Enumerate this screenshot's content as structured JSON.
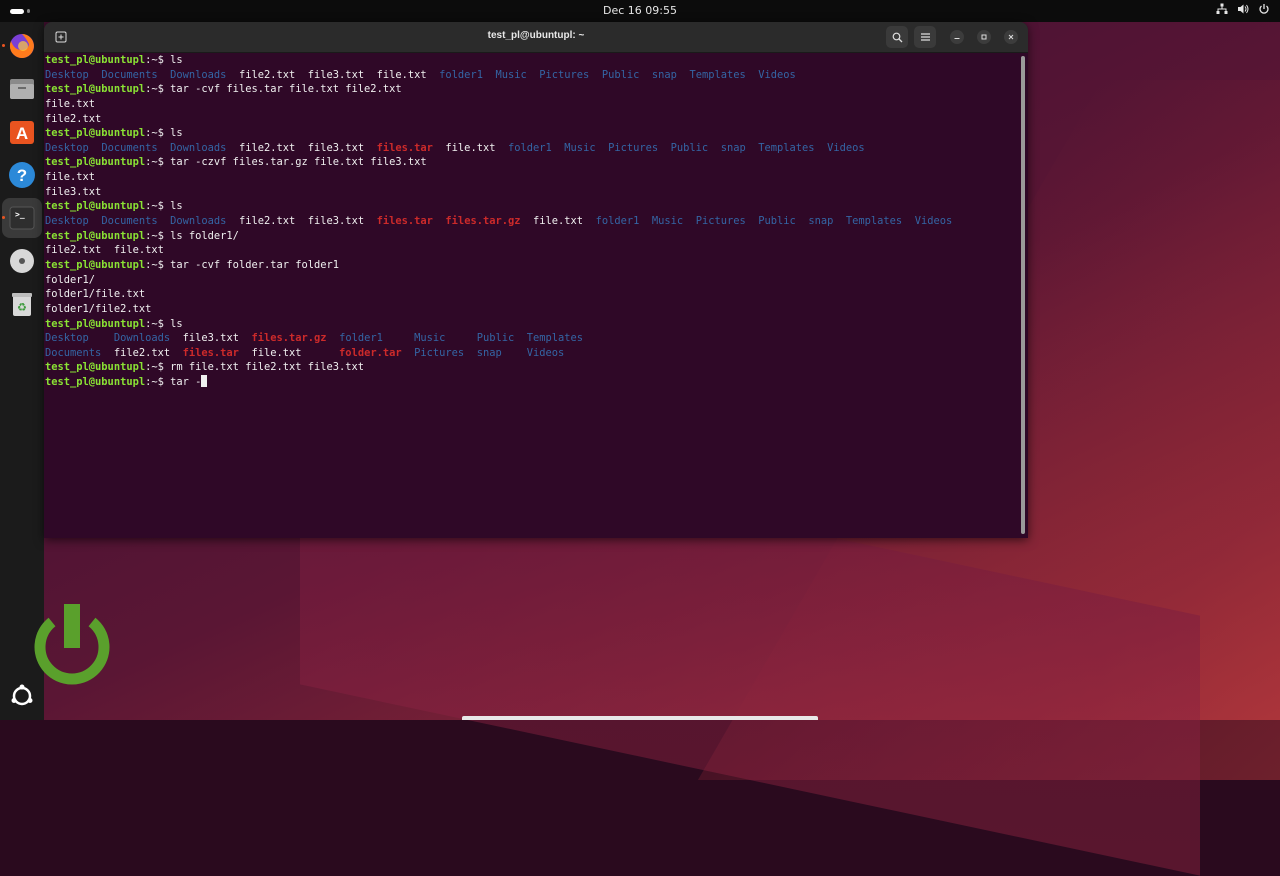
{
  "topbar": {
    "clock": "Dec 16  09:55",
    "tray_icons": [
      "network-icon",
      "volume-icon",
      "power-icon"
    ]
  },
  "dock": {
    "items": [
      "firefox-icon",
      "files-icon",
      "app-center-icon",
      "help-icon",
      "terminal-icon",
      "disc-icon",
      "trash-icon"
    ],
    "apps_icon": "show-apps-icon"
  },
  "terminal": {
    "title": "test_pl@ubuntupl: ~",
    "prompt_user": "test_pl@ubuntupl",
    "prompt_sep": ":~$ ",
    "lines": [
      {
        "type": "cmd",
        "text": "ls"
      },
      {
        "type": "out",
        "parts": [
          [
            "dir",
            "Desktop"
          ],
          [
            "pc",
            "  "
          ],
          [
            "dir",
            "Documents"
          ],
          [
            "pc",
            "  "
          ],
          [
            "dir",
            "Downloads"
          ],
          [
            "pc",
            "  file2.txt  file3.txt  file.txt  "
          ],
          [
            "dir",
            "folder1"
          ],
          [
            "pc",
            "  "
          ],
          [
            "dir",
            "Music"
          ],
          [
            "pc",
            "  "
          ],
          [
            "dir",
            "Pictures"
          ],
          [
            "pc",
            "  "
          ],
          [
            "dir",
            "Public"
          ],
          [
            "pc",
            "  "
          ],
          [
            "dir",
            "snap"
          ],
          [
            "pc",
            "  "
          ],
          [
            "dir",
            "Templates"
          ],
          [
            "pc",
            "  "
          ],
          [
            "dir",
            "Videos"
          ]
        ]
      },
      {
        "type": "cmd",
        "text": "tar -cvf files.tar file.txt file2.txt"
      },
      {
        "type": "out",
        "parts": [
          [
            "pc",
            "file.txt"
          ]
        ]
      },
      {
        "type": "out",
        "parts": [
          [
            "pc",
            "file2.txt"
          ]
        ]
      },
      {
        "type": "cmd",
        "text": "ls"
      },
      {
        "type": "out",
        "parts": [
          [
            "dir",
            "Desktop"
          ],
          [
            "pc",
            "  "
          ],
          [
            "dir",
            "Documents"
          ],
          [
            "pc",
            "  "
          ],
          [
            "dir",
            "Downloads"
          ],
          [
            "pc",
            "  file2.txt  file3.txt  "
          ],
          [
            "arc",
            "files.tar"
          ],
          [
            "pc",
            "  file.txt  "
          ],
          [
            "dir",
            "folder1"
          ],
          [
            "pc",
            "  "
          ],
          [
            "dir",
            "Music"
          ],
          [
            "pc",
            "  "
          ],
          [
            "dir",
            "Pictures"
          ],
          [
            "pc",
            "  "
          ],
          [
            "dir",
            "Public"
          ],
          [
            "pc",
            "  "
          ],
          [
            "dir",
            "snap"
          ],
          [
            "pc",
            "  "
          ],
          [
            "dir",
            "Templates"
          ],
          [
            "pc",
            "  "
          ],
          [
            "dir",
            "Videos"
          ]
        ]
      },
      {
        "type": "cmd",
        "text": "tar -czvf files.tar.gz file.txt file3.txt"
      },
      {
        "type": "out",
        "parts": [
          [
            "pc",
            "file.txt"
          ]
        ]
      },
      {
        "type": "out",
        "parts": [
          [
            "pc",
            "file3.txt"
          ]
        ]
      },
      {
        "type": "cmd",
        "text": "ls"
      },
      {
        "type": "out",
        "parts": [
          [
            "dir",
            "Desktop"
          ],
          [
            "pc",
            "  "
          ],
          [
            "dir",
            "Documents"
          ],
          [
            "pc",
            "  "
          ],
          [
            "dir",
            "Downloads"
          ],
          [
            "pc",
            "  file2.txt  file3.txt  "
          ],
          [
            "arc",
            "files.tar"
          ],
          [
            "pc",
            "  "
          ],
          [
            "arc",
            "files.tar.gz"
          ],
          [
            "pc",
            "  file.txt  "
          ],
          [
            "dir",
            "folder1"
          ],
          [
            "pc",
            "  "
          ],
          [
            "dir",
            "Music"
          ],
          [
            "pc",
            "  "
          ],
          [
            "dir",
            "Pictures"
          ],
          [
            "pc",
            "  "
          ],
          [
            "dir",
            "Public"
          ],
          [
            "pc",
            "  "
          ],
          [
            "dir",
            "snap"
          ],
          [
            "pc",
            "  "
          ],
          [
            "dir",
            "Templates"
          ],
          [
            "pc",
            "  "
          ],
          [
            "dir",
            "Videos"
          ]
        ]
      },
      {
        "type": "cmd",
        "text": "ls folder1/"
      },
      {
        "type": "out",
        "parts": [
          [
            "pc",
            "file2.txt  file.txt"
          ]
        ]
      },
      {
        "type": "cmd",
        "text": "tar -cvf folder.tar folder1"
      },
      {
        "type": "out",
        "parts": [
          [
            "pc",
            "folder1/"
          ]
        ]
      },
      {
        "type": "out",
        "parts": [
          [
            "pc",
            "folder1/file.txt"
          ]
        ]
      },
      {
        "type": "out",
        "parts": [
          [
            "pc",
            "folder1/file2.txt"
          ]
        ]
      },
      {
        "type": "cmd",
        "text": "ls"
      },
      {
        "type": "out",
        "parts": [
          [
            "dir",
            "Desktop"
          ],
          [
            "pc",
            "    "
          ],
          [
            "dir",
            "Downloads"
          ],
          [
            "pc",
            "  file3.txt  "
          ],
          [
            "arc",
            "files.tar.gz"
          ],
          [
            "pc",
            "  "
          ],
          [
            "dir",
            "folder1"
          ],
          [
            "pc",
            "     "
          ],
          [
            "dir",
            "Music"
          ],
          [
            "pc",
            "     "
          ],
          [
            "dir",
            "Public"
          ],
          [
            "pc",
            "  "
          ],
          [
            "dir",
            "Templates"
          ]
        ]
      },
      {
        "type": "out",
        "parts": [
          [
            "dir",
            "Documents"
          ],
          [
            "pc",
            "  file2.txt  "
          ],
          [
            "arc",
            "files.tar"
          ],
          [
            "pc",
            "  file.txt      "
          ],
          [
            "arc",
            "folder.tar"
          ],
          [
            "pc",
            "  "
          ],
          [
            "dir",
            "Pictures"
          ],
          [
            "pc",
            "  "
          ],
          [
            "dir",
            "snap"
          ],
          [
            "pc",
            "    "
          ],
          [
            "dir",
            "Videos"
          ]
        ]
      },
      {
        "type": "cmd",
        "text": "rm file.txt file2.txt file3.txt"
      },
      {
        "type": "cmd",
        "text": "tar -",
        "cursor": true
      }
    ]
  },
  "colors": {
    "terminal_bg": "#2f0827",
    "prompt": "#8ae234",
    "directory": "#3465a4",
    "archive": "#cc2a2a",
    "logo_green": "#5aa02c"
  }
}
